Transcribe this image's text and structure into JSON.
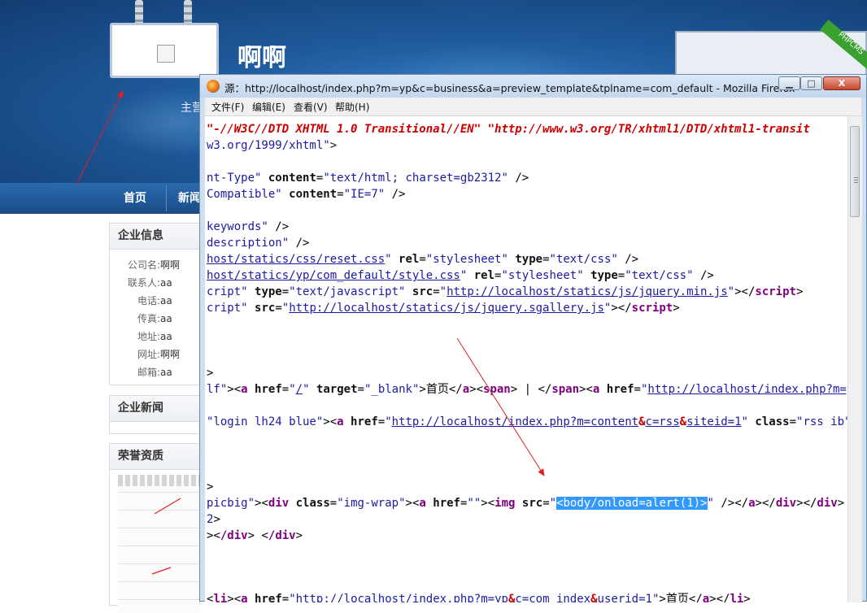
{
  "site": {
    "name": "啊啊",
    "subtitle": "主营",
    "nav": [
      "首页",
      "新闻"
    ]
  },
  "sidebar": {
    "company_info": {
      "title": "企业信息",
      "rows": [
        {
          "label": "公司名:",
          "value": "啊啊"
        },
        {
          "label": "联系人:",
          "value": "aa"
        },
        {
          "label": "电话:",
          "value": "aa"
        },
        {
          "label": "传真:",
          "value": "aa"
        },
        {
          "label": "地址:",
          "value": "aa"
        },
        {
          "label": "网址:",
          "value": "啊啊"
        },
        {
          "label": "邮箱:",
          "value": "aa"
        }
      ]
    },
    "company_news": {
      "title": "企业新闻"
    },
    "honors": {
      "title": "荣誉资质"
    }
  },
  "window": {
    "title": "源：http://localhost/index.php?m=yp&c=business&a=preview_template&tplname=com_default - Mozilla Firefox",
    "menu": [
      "文件(F)",
      "编辑(E)",
      "查看(V)",
      "帮助(H)"
    ],
    "controls": {
      "minimize": "▁",
      "maximize": "□",
      "close": "X"
    }
  },
  "source": {
    "doctype_fpi": "\"-//W3C//DTD XHTML 1.0 Transitional//EN\"",
    "doctype_dtd": "\"http://www.w3.org/TR/xhtml1/DTD/xhtml1-transit",
    "xmlns_tail": "w3.org/1999/xhtml\"",
    "meta_http_equiv": "nt-Type\"",
    "meta_content_attr": "content",
    "meta_content_val": "\"text/html; charset=gb2312\"",
    "meta_compat": "Compatible\"",
    "meta_compat_val": "\"IE=7\"",
    "meta_keywords": "keywords\"",
    "meta_description": "description\"",
    "css_reset": "host/statics/css/reset.css",
    "css_style": "host/statics/yp/com_default/style.css",
    "rel_attr": "rel",
    "rel_val": "\"stylesheet\"",
    "type_attr": "type",
    "type_css": "\"text/css\"",
    "type_js": "\"text/javascript\"",
    "src_attr": "src",
    "script_jquery_pre": "cript\"",
    "script_sgallery_pre": "cript\"",
    "js_jquery": "http://localhost/statics/js/jquery.min.js",
    "js_sgallery": "http://localhost/statics/js/jquery.sgallery.js",
    "script_tag": "script",
    "gt": ">",
    "nav_pre": "lf\"",
    "a_tag": "a",
    "href_attr": "href",
    "href_root": "/",
    "target_attr": "target",
    "target_val": "\"_blank\"",
    "home_text": "首页",
    "span_tag": "span",
    "pipe_text": " | ",
    "nav_url": "http://localhost/index.php?m=yp",
    "login_class": "\"login lh24 blue\"",
    "rss_url_1": "http://localhost/index.php?m=content",
    "rss_url_2": "c=rss",
    "rss_url_3": "siteid=1",
    "amp": "&",
    "class_attr": "class",
    "rss_class": "\"rss ib\"",
    "rss_tail": "rs",
    "picbig": " picbig\"",
    "div_tag": "div",
    "img_wrap": "\"img-wrap\"",
    "empty_href": "\"\"",
    "img_tag": "img",
    "payload": "<body/onload=alert(1)>",
    "close_tail": "/div",
    "q2": "2",
    "li_url": "http://localhost/index.php?m=yp",
    "li_url_2": "c=com_index",
    "li_url_3": "userid=1",
    "li_text": "首页",
    "li_tag": "li"
  }
}
